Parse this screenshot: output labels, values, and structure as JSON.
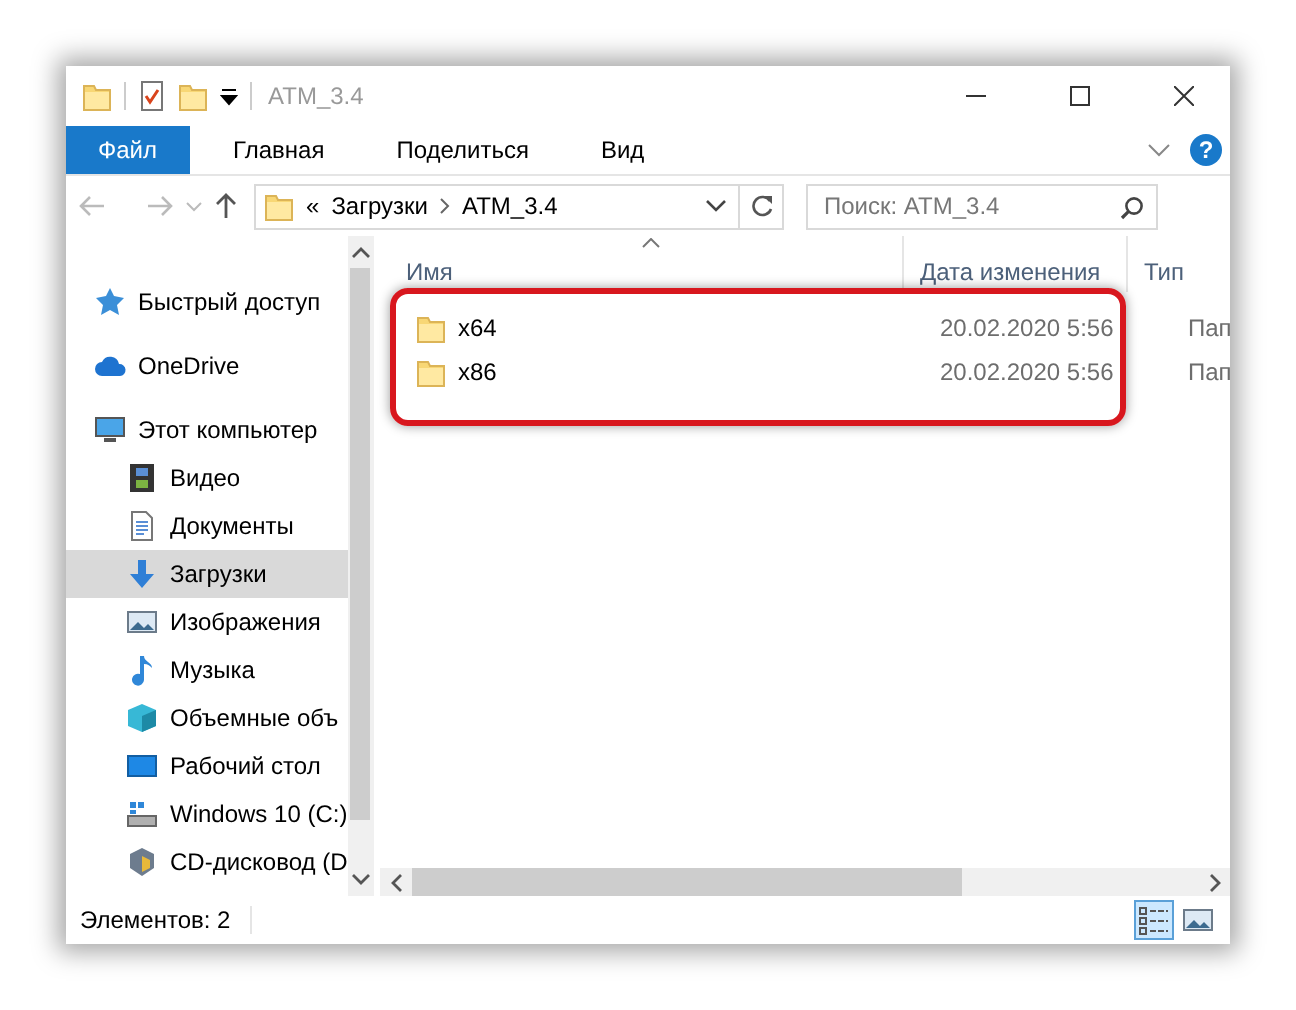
{
  "window": {
    "title": "ATM_3.4"
  },
  "ribbon": {
    "tabs": [
      {
        "label": "Файл",
        "selected": true
      },
      {
        "label": "Главная",
        "selected": false
      },
      {
        "label": "Поделиться",
        "selected": false
      },
      {
        "label": "Вид",
        "selected": false
      }
    ],
    "help": "?"
  },
  "address_bar": {
    "overflow": "«",
    "path": [
      "Загрузки",
      "ATM_3.4"
    ]
  },
  "search": {
    "placeholder": "Поиск: ATM_3.4"
  },
  "sidebar": {
    "items": [
      {
        "label": "Быстрый доступ",
        "kind": "star",
        "selected": false
      },
      {
        "label": "OneDrive",
        "kind": "cloud",
        "selected": false
      },
      {
        "label": "Этот компьютер",
        "kind": "computer",
        "selected": false,
        "children": [
          {
            "label": "Видео",
            "kind": "video",
            "selected": false
          },
          {
            "label": "Документы",
            "kind": "documents",
            "selected": false
          },
          {
            "label": "Загрузки",
            "kind": "downloads",
            "selected": true
          },
          {
            "label": "Изображения",
            "kind": "pictures",
            "selected": false
          },
          {
            "label": "Музыка",
            "kind": "music",
            "selected": false
          },
          {
            "label": "Объемные объ",
            "kind": "objects",
            "selected": false
          },
          {
            "label": "Рабочий стол",
            "kind": "desktop",
            "selected": false
          },
          {
            "label": "Windows 10 (C:)",
            "kind": "drive",
            "selected": false
          },
          {
            "label": "CD-дисковод (D",
            "kind": "cd",
            "selected": false
          }
        ]
      }
    ]
  },
  "table": {
    "columns": [
      {
        "label": "Имя",
        "sorted": true
      },
      {
        "label": "Дата изменения",
        "sorted": false
      },
      {
        "label": "Тип",
        "sorted": false
      }
    ],
    "rows": [
      {
        "name": "x64",
        "date": "20.02.2020 5:56",
        "type": "Пап"
      },
      {
        "name": "x86",
        "date": "20.02.2020 5:56",
        "type": "Пап"
      }
    ]
  },
  "status_bar": {
    "text": "Элементов: 2",
    "views": [
      {
        "kind": "details",
        "selected": true
      },
      {
        "kind": "tiles",
        "selected": false
      }
    ]
  }
}
